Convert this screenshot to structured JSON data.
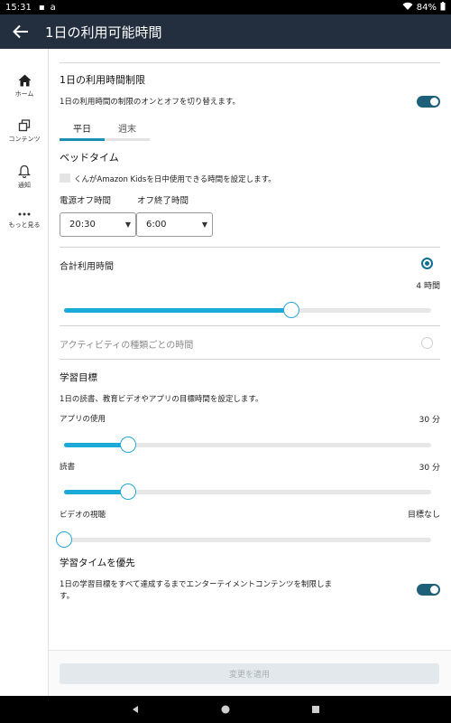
{
  "status_bar": {
    "time": "15:31",
    "battery": "84%"
  },
  "app_bar": {
    "title": "1日の利用可能時間"
  },
  "side_nav": {
    "items": [
      {
        "label": "ホーム",
        "icon": "home-icon"
      },
      {
        "label": "コンテンツ",
        "icon": "content-icon"
      },
      {
        "label": "通知",
        "icon": "bell-icon"
      },
      {
        "label": "もっと見る",
        "icon": "more-icon"
      }
    ]
  },
  "daily_limit": {
    "title": "1日の利用時間制限",
    "description": "1日の利用時間の制限のオンとオフを切り替えます。",
    "enabled": true
  },
  "tabs": [
    "平日",
    "週末"
  ],
  "bedtime": {
    "title": "ベッドタイム",
    "description": "くんがAmazon Kidsを日中使用できる時間を設定します。",
    "power_off_label": "電源オフ時間",
    "off_end_label": "オフ終了時間",
    "power_off_value": "20:30",
    "off_end_value": "6:00"
  },
  "total_time": {
    "label": "合計利用時間",
    "value": "4 時間",
    "slider_fraction": 0.62
  },
  "activity_time": {
    "label": "アクティビティの種類ごとの時間"
  },
  "learning_goals": {
    "title": "学習目標",
    "description": "1日の読書、教育ビデオやアプリの目標時間を設定します。",
    "items": [
      {
        "label": "アプリの使用",
        "value": "30 分",
        "slider_fraction": 0.175
      },
      {
        "label": "読書",
        "value": "30 分",
        "slider_fraction": 0.175
      },
      {
        "label": "ビデオの視聴",
        "value": "目標なし",
        "slider_fraction": 0.0
      }
    ]
  },
  "learning_priority": {
    "title": "学習タイムを優先",
    "description_line1": "1日の学習目標をすべて達成するまでエンターテイメントコンテンツを制限しま",
    "description_line2": "す。",
    "enabled": true
  },
  "apply_button": {
    "label": "変更を適用"
  },
  "colors": {
    "accent": "#1ba9d8",
    "toggle": "#1e5f7a",
    "app_bar": "#232f3e"
  }
}
